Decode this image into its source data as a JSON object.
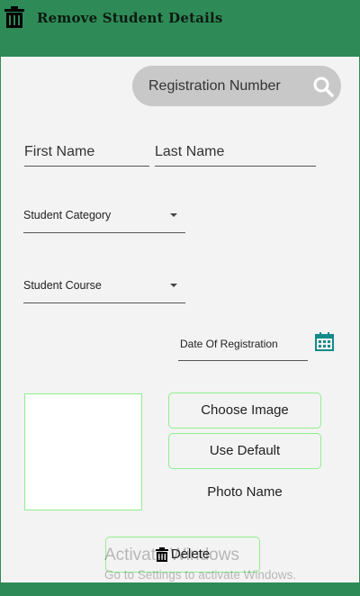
{
  "header": {
    "title": "Remove Student Details",
    "icon": "trash-icon",
    "color": "#2e8b57"
  },
  "search": {
    "placeholder": "Registration Number",
    "icon": "search-icon"
  },
  "name_fields": {
    "first_placeholder": "First Name",
    "last_placeholder": "Last Name"
  },
  "category": {
    "label": "Student Category"
  },
  "course": {
    "label": "Student Course"
  },
  "registration_date": {
    "label": "Date Of Registration",
    "icon": "calendar-icon"
  },
  "photo": {
    "choose_label": "Choose Image",
    "default_label": "Use Default",
    "name_label": "Photo Name",
    "border_color": "#90ee90"
  },
  "actions": {
    "delete_label": "Delete",
    "delete_icon": "trash-icon"
  },
  "watermark": {
    "line1": "Activate Windows",
    "line2": "Go to Settings to activate Windows."
  }
}
